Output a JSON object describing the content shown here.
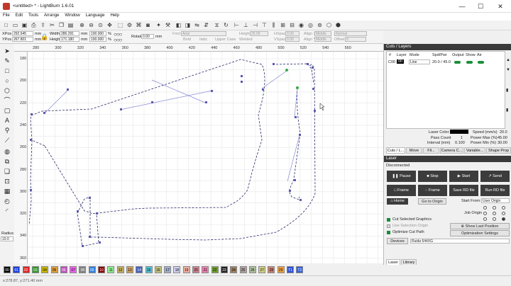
{
  "window": {
    "title": "<untitled> * - LightBurn 1.6.01",
    "minimize": "—",
    "maximize": "☐",
    "close": "✕"
  },
  "menu": [
    "File",
    "Edit",
    "Tools",
    "Arrange",
    "Window",
    "Language",
    "Help"
  ],
  "props": {
    "xpos_label": "XPos",
    "xpos": "292.645",
    "ypos_label": "YPos",
    "ypos": "267.801",
    "width_label": "Width",
    "width": "286.291",
    "height_label": "Height",
    "height": "171.180",
    "unit": "mm",
    "scale_w": "100.000",
    "scale_h": "100.000",
    "pct": "%",
    "rotate_label": "Rotate",
    "rotate": "0.00",
    "rotate_unit": "mm",
    "font_label": "Font",
    "font": "Arial",
    "font_height_label": "Height",
    "font_height": "25.00",
    "hspace_label": "HSpace",
    "hspace": "0.00",
    "vspace_label": "VSpace",
    "vspace": "0.00",
    "alignx_label": "Align X",
    "alignx": "Middle",
    "aligny_label": "Align Y",
    "aligny": "Middle",
    "normal": "Normal",
    "offset_label": "Offset",
    "offset": "0",
    "bold": "Bold",
    "italic": "Italic",
    "upper": "Upper Case",
    "welded": "Welded",
    "distort": "Distort"
  },
  "ruler": {
    "x_ticks": [
      "280",
      "300",
      "320",
      "340",
      "360",
      "380",
      "400",
      "420",
      "440",
      "460",
      "480",
      "500",
      "520",
      "540",
      "560"
    ],
    "y_ticks": [
      "180",
      "200",
      "220",
      "240",
      "260",
      "280",
      "300",
      "320",
      "340",
      "360"
    ]
  },
  "left_tools": {
    "radius_label": "Radius",
    "radius": "10.0"
  },
  "cuts": {
    "title": "Cuts / Layers",
    "headers": [
      "#",
      "Layer",
      "Mode",
      "Spd/Pwr",
      "Output",
      "Show",
      "Air"
    ],
    "row": {
      "num": "C00",
      "layer": "00",
      "mode": "Line",
      "spdpwr": "20.0 / 45.0"
    },
    "laser_color_label": "Laser Color",
    "pass_count_label": "Pass Count",
    "pass_count": "1",
    "interval_label": "Interval (mm)",
    "interval": "0.100",
    "speed_label": "Speed (mm/s)",
    "speed": "20.0",
    "powermax_label": "Power Max (%)",
    "powermax": "45.00",
    "powermin_label": "Power Min (%)",
    "powermin": "30.00"
  },
  "tabs_top": [
    "Cuts / L...",
    "Move",
    "Fil...",
    "Camera C...",
    "Variable...",
    "Shape Prop"
  ],
  "laser": {
    "title": "Laser",
    "status": "Disconnected",
    "pause": "Pause",
    "stop": "Stop",
    "start": "Start",
    "send": "Send",
    "frame": "Frame",
    "frame2": "Frame",
    "save_rd": "Save RD file",
    "run_rd": "Run RD file",
    "home": "Home",
    "go_origin": "Go to Origin",
    "start_from_label": "Start From:",
    "start_from": "User Origin",
    "job_origin_label": "Job Origin",
    "cut_selected": "Cut Selected Graphics",
    "use_selection": "Use Selection Origin",
    "optimize": "Optimize Cut Path",
    "show_last": "Show Last Position",
    "opt_settings": "Optimization Settings",
    "devices": "Devices",
    "device": "Ruida 644XG"
  },
  "tabs_bottom": [
    "Laser",
    "Library"
  ],
  "palette": [
    "00",
    "01",
    "02",
    "03",
    "04",
    "05",
    "06",
    "07",
    "08",
    "09",
    "10",
    "11",
    "12",
    "13",
    "14",
    "15",
    "16",
    "17",
    "18",
    "19",
    "20",
    "21",
    "22",
    "23",
    "24",
    "25",
    "26",
    "27",
    "28",
    "29",
    "T1",
    "T2"
  ],
  "palette_colors": [
    "#000000",
    "#1e3fdc",
    "#e02020",
    "#2a9a2a",
    "#c8b800",
    "#e0a040",
    "#c050c0",
    "#f060f0",
    "#808080",
    "#3080e0",
    "#8b0000",
    "#90ee90",
    "#c0b060",
    "#d0a060",
    "#4060c0",
    "#50c0d0",
    "#c0c080",
    "#a0b0d0",
    "#d0d0f0",
    "#f0b0a0",
    "#d08090",
    "#f080b0",
    "#70a030",
    "#202020",
    "#a08060",
    "#b0a0a0",
    "#b0c0a0",
    "#d0d080",
    "#d08070",
    "#f0a040",
    "#3050d0",
    "#3060e0"
  ],
  "status": {
    "coords": "x:278.87, y:271.40 mm"
  }
}
